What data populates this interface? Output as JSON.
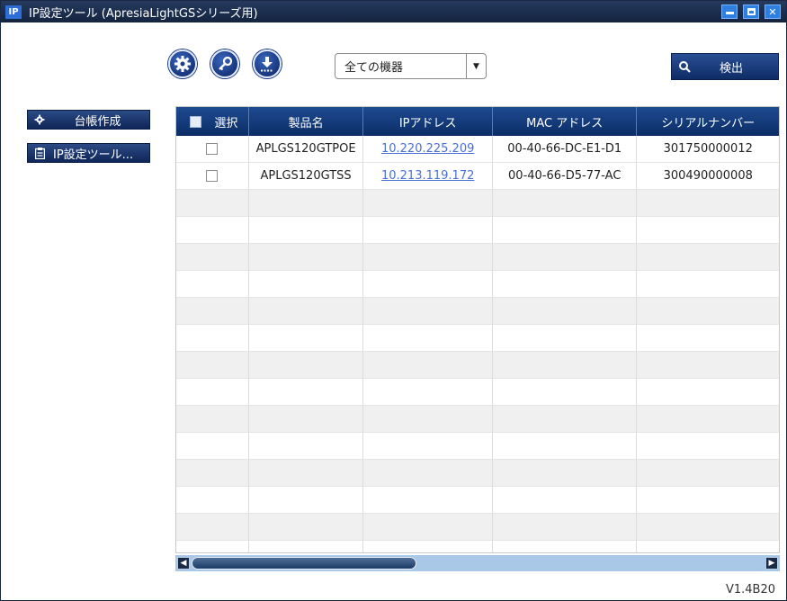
{
  "window": {
    "title": "IP設定ツール (ApresiaLightGSシリーズ用)",
    "app_badge": "IP"
  },
  "toolbar": {
    "filter_select": {
      "value": "全ての機器",
      "arrow": "▼"
    },
    "detect_button": {
      "label": "検出"
    },
    "icons": [
      "settings-icon",
      "key-icon",
      "download-icon",
      "search-icon"
    ]
  },
  "sidebar": {
    "items": [
      {
        "label": "台帳作成",
        "icon": "gear-icon"
      },
      {
        "label": "IP設定ツール...",
        "icon": "clipboard-icon"
      }
    ]
  },
  "grid": {
    "columns": [
      "選択",
      "製品名",
      "IPアドレス",
      "MAC アドレス",
      "シリアルナンバー"
    ],
    "rows": [
      {
        "product": "APLGS120GTPOE",
        "ip": "10.220.225.209",
        "mac": "00-40-66-DC-E1-D1",
        "serial": "301750000012",
        "selected": false
      },
      {
        "product": "APLGS120GTSS",
        "ip": "10.213.119.172",
        "mac": "00-40-66-D5-77-AC",
        "serial": "300490000008",
        "selected": false
      }
    ]
  },
  "footer": {
    "version": "V1.4B20"
  },
  "colors": {
    "header_bg": "#0c2d66",
    "link": "#4a6fd8",
    "scroll_track": "#a9c7e6"
  }
}
